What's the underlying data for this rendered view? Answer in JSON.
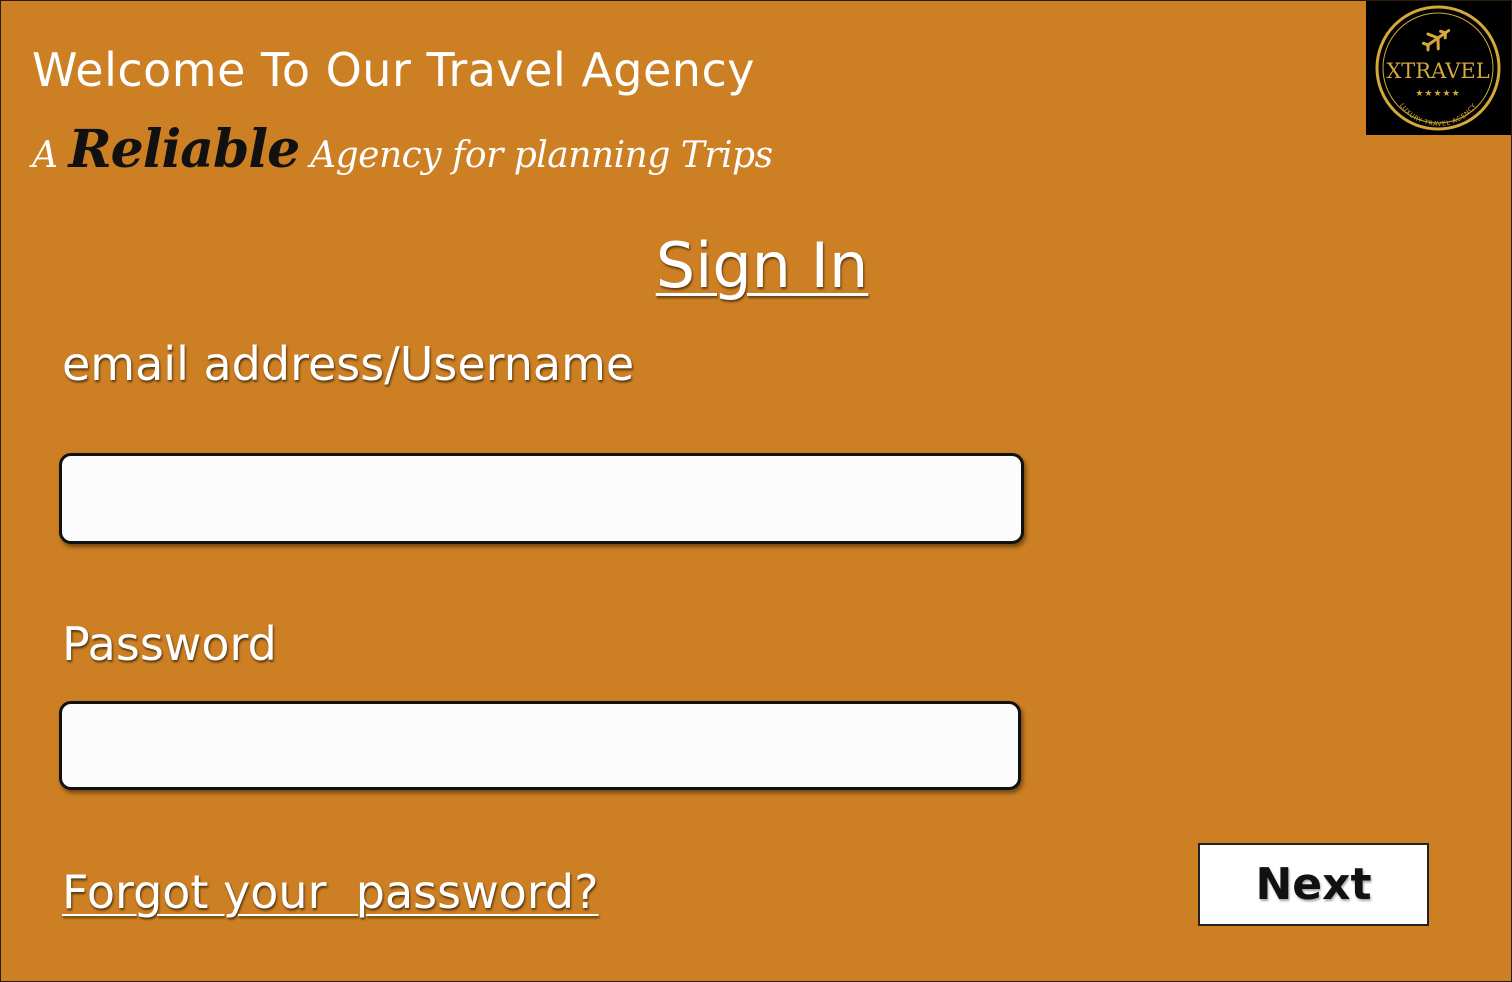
{
  "header": {
    "welcome": "Welcome To Our Travel Agency",
    "tagline_prefix": "A ",
    "tagline_highlight": "Reliable",
    "tagline_suffix": " Agency for planning Trips"
  },
  "logo": {
    "brand": "XTRAVEL",
    "stars": "★★★★★",
    "subtitle": "LUXURY TRAVEL AGENCY",
    "icon": "airplane-icon"
  },
  "form": {
    "title": "Sign In",
    "email_label": "email address/Username",
    "email_value": "",
    "email_placeholder": "",
    "password_label": "Password",
    "password_value": "",
    "password_placeholder": "",
    "forgot_link": "Forgot your  password?",
    "next_button": "Next"
  },
  "colors": {
    "background": "#cd7f23",
    "logo_background": "#000000",
    "logo_gold": "#d4a83a",
    "text": "#ffffff",
    "input_background": "#fdfcfd",
    "button_background": "#ffffff"
  }
}
